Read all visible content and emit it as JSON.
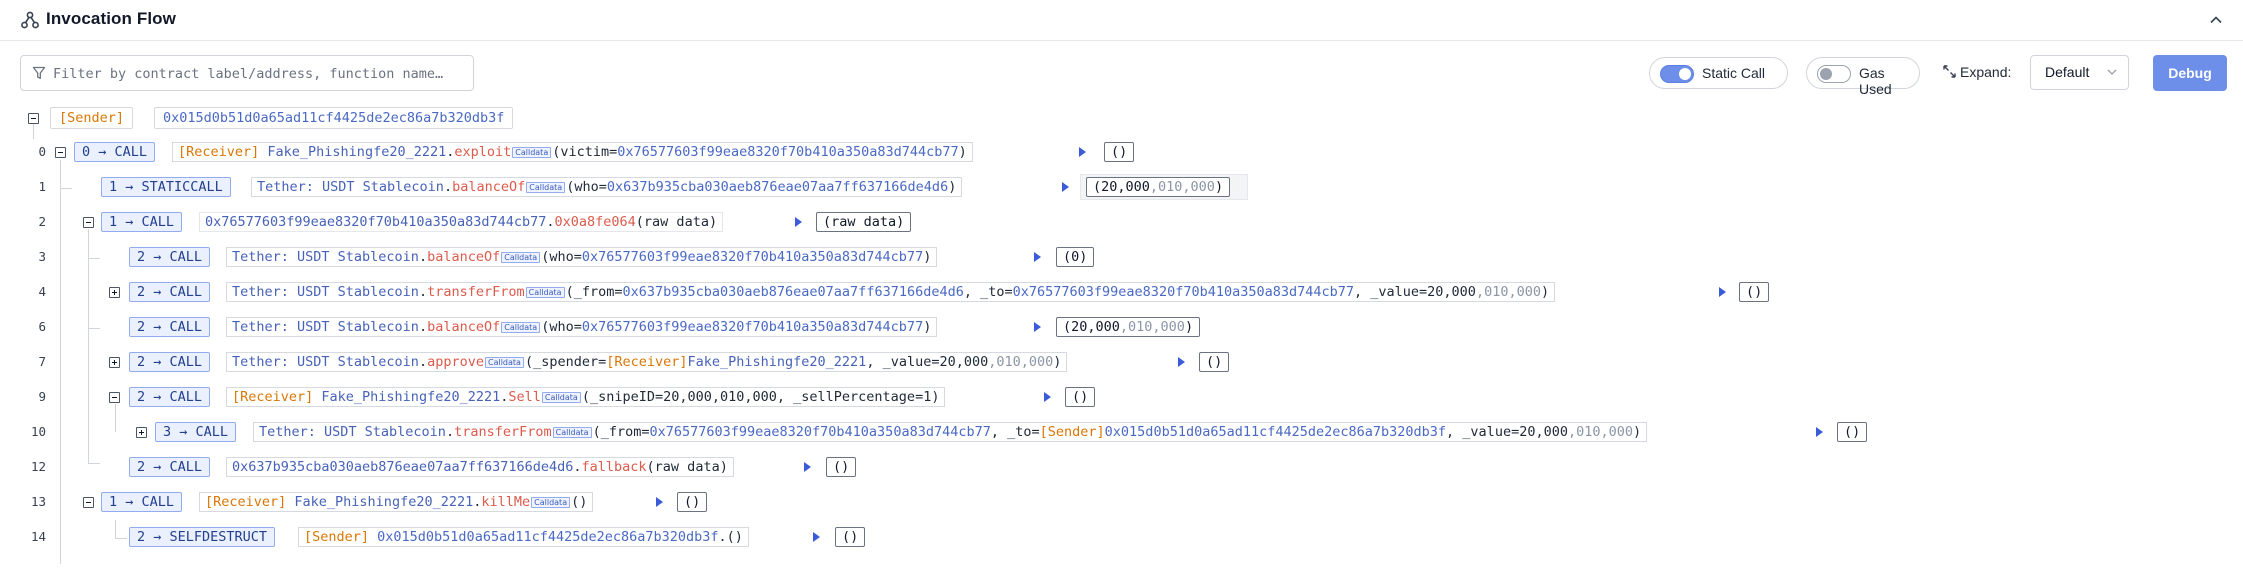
{
  "header": {
    "title": "Invocation Flow"
  },
  "toolbar": {
    "filter_placeholder": "Filter by contract label/address, function name…",
    "static_call_label": "Static Call",
    "gas_used_label": "Gas Used",
    "expand_label": "Expand:",
    "expand_value": "Default",
    "debug_label": "Debug"
  },
  "colors": {
    "accent": "#6d8ee9",
    "receiver": "#d97706",
    "function": "#db5b4c",
    "address": "#4a69c4"
  },
  "sender": {
    "tag": "[Sender]",
    "address": "0x015d0b51d0a65ad11cf4425de2ec86a7b320db3f"
  },
  "calldata_tag": "Calldata",
  "rows": [
    {
      "num": "0",
      "badge": "0 → CALL",
      "receiver": "[Receiver] ",
      "contract": "Fake_Phishingfe20_2221",
      "dot": ".",
      "fn": "exploit",
      "p1": "(victim=",
      "a1": "0x76577603f99eae8320f70b410a350a83d744cb77",
      "p2": ")",
      "output": "()"
    },
    {
      "num": "1",
      "badge": "1 → STATICCALL",
      "contract": "Tether: USDT Stablecoin",
      "dot": ".",
      "fn": "balanceOf",
      "p1": "(who=",
      "a1": "0x637b935cba030aeb876eae07aa7ff637166de4d6",
      "p2": ")",
      "out_a": "(20,000",
      "out_b": ",010,000",
      "out_c": ")"
    },
    {
      "num": "2",
      "badge": "1 → CALL",
      "contract": "0x76577603f99eae8320f70b410a350a83d744cb77",
      "dot": ".",
      "fn": "0x0a8fe064",
      "p1": "(raw data)",
      "output": "(raw data)"
    },
    {
      "num": "3",
      "badge": "2 → CALL",
      "contract": "Tether: USDT Stablecoin",
      "dot": ".",
      "fn": "balanceOf",
      "p1": "(who=",
      "a1": "0x76577603f99eae8320f70b410a350a83d744cb77",
      "p2": ")",
      "output": "(0)"
    },
    {
      "num": "4",
      "badge": "2 → CALL",
      "contract": "Tether: USDT Stablecoin",
      "dot": ".",
      "fn": "transferFrom",
      "p1": "(_from=",
      "a1": "0x637b935cba030aeb876eae07aa7ff637166de4d6",
      "p2": ", _to=",
      "a2": "0x76577603f99eae8320f70b410a350a83d744cb77",
      "p3": ", _value=20,000",
      "m1": ",010,000",
      "p4": ")",
      "output": "()"
    },
    {
      "num": "6",
      "badge": "2 → CALL",
      "contract": "Tether: USDT Stablecoin",
      "dot": ".",
      "fn": "balanceOf",
      "p1": "(who=",
      "a1": "0x76577603f99eae8320f70b410a350a83d744cb77",
      "p2": ")",
      "out_a": "(20,000",
      "out_b": ",010,000",
      "out_c": ")"
    },
    {
      "num": "7",
      "badge": "2 → CALL",
      "contract": "Tether: USDT Stablecoin",
      "dot": ".",
      "fn": "approve",
      "p1": "(_spender=",
      "r1": "[Receiver]",
      "p1b": "Fake_Phishingfe20_2221",
      "p2": ", _value=20,000",
      "m1": ",010,000",
      "p3": ")",
      "output": "()"
    },
    {
      "num": "9",
      "badge": "2 → CALL",
      "receiver": "[Receiver] ",
      "contract": "Fake_Phishingfe20_2221",
      "dot": ".",
      "fn": "Sell",
      "p1": "(_snipeID=20,000,010,000, _sellPercentage=1)",
      "output": "()"
    },
    {
      "num": "10",
      "badge": "3 → CALL",
      "contract": "Tether: USDT Stablecoin",
      "dot": ".",
      "fn": "transferFrom",
      "p1": "(_from=",
      "a1": "0x76577603f99eae8320f70b410a350a83d744cb77",
      "p2": ", _to=",
      "s1": "[Sender]",
      "a2": "0x015d0b51d0a65ad11cf4425de2ec86a7b320db3f",
      "p3": ", _value=20,000",
      "m1": ",010,000",
      "p4": ")",
      "output": "()"
    },
    {
      "num": "12",
      "badge": "2 → CALL",
      "contract": "0x637b935cba030aeb876eae07aa7ff637166de4d6",
      "dot": ".",
      "fn": "fallback",
      "p1": "(raw data)",
      "output": "()"
    },
    {
      "num": "13",
      "badge": "1 → CALL",
      "receiver": "[Receiver] ",
      "contract": "Fake_Phishingfe20_2221",
      "dot": ".",
      "fn": "killMe",
      "p1": "()",
      "output": "()"
    },
    {
      "num": "14",
      "badge": "2 → SELFDESTRUCT",
      "sender_tag": "[Sender] ",
      "address": "0x015d0b51d0a65ad11cf4425de2ec86a7b320db3f",
      "p1": ".()",
      "output": "()"
    }
  ]
}
